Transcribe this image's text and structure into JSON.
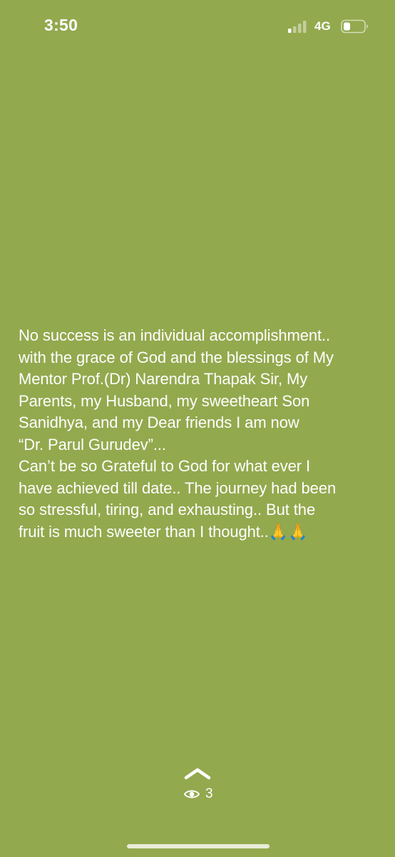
{
  "status_bar": {
    "time": "3:50",
    "network": "4G",
    "signal_icon": "cellular-signal-icon",
    "battery_icon": "battery-icon"
  },
  "story": {
    "background_color": "#93a94e",
    "text_lines": [
      "No success is an individual accomplishment..",
      "with the grace of God and the blessings of My",
      "Mentor Prof.(Dr) Narendra Thapak Sir, My",
      "Parents, my Husband, my sweetheart Son",
      "Sanidhya, and my Dear friends I am now",
      " “Dr. Parul Gurudev”...",
      "Can’t be so Grateful to God for what ever I",
      "have achieved till date.. The journey had been",
      "so stressful, tiring, and exhausting.. But the",
      "fruit is much sweeter than I thought..🙏🙏"
    ]
  },
  "footer": {
    "swipe_icon": "chevron-up-icon",
    "views_icon": "eye-icon",
    "views_count": "3"
  }
}
